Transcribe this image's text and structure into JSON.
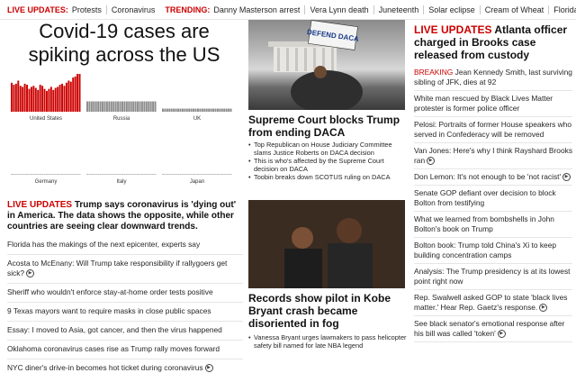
{
  "topbar": {
    "live_label": "LIVE UPDATES:",
    "live_items": [
      "Protests",
      "Coronavirus"
    ],
    "trending_label": "TRENDING:",
    "trending_items": [
      "Danny Masterson arrest",
      "Vera Lynn death",
      "Juneteenth",
      "Solar eclipse",
      "Cream of Wheat",
      "Florida bridge"
    ]
  },
  "left": {
    "chart_title": "Covid-19 cases are spiking across the US",
    "live_prefix": "LIVE UPDATES",
    "live_headline": "Trump says coronavirus is 'dying out' in America. The data shows the opposite, while other countries are seeing clear downward trends.",
    "list": [
      {
        "text": "Florida has the makings of the next epicenter, experts say",
        "video": false
      },
      {
        "text": "Acosta to McEnany: Will Trump take responsibility if rallygoers get sick?",
        "video": true
      },
      {
        "text": "Sheriff who wouldn't enforce stay-at-home order tests positive",
        "video": false
      },
      {
        "text": "9 Texas mayors want to require masks in close public spaces",
        "video": false
      },
      {
        "text": "Essay: I moved to Asia, got cancer, and then the virus happened",
        "video": false
      },
      {
        "text": "Oklahoma coronavirus cases rise as Trump rally moves forward",
        "video": false
      },
      {
        "text": "NYC diner's drive-in becomes hot ticket during coronavirus",
        "video": true
      }
    ]
  },
  "chart_data": {
    "type": "bar",
    "panels": [
      {
        "label": "United States",
        "color": "#cc0000",
        "values": [
          28,
          26,
          27,
          30,
          25,
          24,
          27,
          26,
          22,
          24,
          25,
          23,
          21,
          26,
          25,
          22,
          20,
          22,
          24,
          21,
          23,
          24,
          26,
          27,
          25,
          28,
          30,
          29,
          33,
          34,
          37,
          40
        ]
      },
      {
        "label": "Russia",
        "color": "#8c8c8c",
        "values": [
          10,
          10,
          10,
          10,
          10,
          10,
          10,
          10,
          10,
          10,
          10,
          10,
          10,
          10,
          10,
          10,
          10,
          10,
          10,
          10,
          10,
          10,
          10,
          10,
          10,
          10,
          10,
          10,
          10,
          10,
          10,
          10
        ]
      },
      {
        "label": "UK",
        "color": "#8c8c8c",
        "values": [
          3,
          3,
          3,
          3,
          3,
          3,
          3,
          3,
          3,
          3,
          3,
          3,
          3,
          3,
          3,
          3,
          3,
          3,
          3,
          3,
          3,
          3,
          3,
          3,
          3,
          3,
          3,
          3,
          3,
          3,
          3,
          3
        ]
      },
      {
        "label": "Germany",
        "color": "#8c8c8c",
        "values": [
          0.5,
          0.5,
          0.5,
          0.5,
          0.5,
          0.5,
          0.5,
          0.5,
          0.5,
          0.5,
          0.5,
          0.5,
          0.5,
          0.5,
          0.5,
          0.5,
          0.5,
          0.5,
          0.5,
          0.5,
          0.5,
          0.5,
          0.5,
          0.5,
          0.5,
          0.5,
          0.5,
          0.5,
          0.5,
          0.5,
          0.5,
          0.5
        ]
      },
      {
        "label": "Italy",
        "color": "#8c8c8c",
        "values": [
          0.5,
          0.5,
          0.5,
          0.5,
          0.5,
          0.5,
          0.5,
          0.5,
          0.5,
          0.5,
          0.5,
          0.5,
          0.5,
          0.5,
          0.5,
          0.5,
          0.5,
          0.5,
          0.5,
          0.5,
          0.5,
          0.5,
          0.5,
          0.5,
          0.5,
          0.5,
          0.5,
          0.5,
          0.5,
          0.5,
          0.5,
          0.5
        ]
      },
      {
        "label": "Japan",
        "color": "#8c8c8c",
        "values": [
          0.2,
          0.2,
          0.2,
          0.2,
          0.2,
          0.2,
          0.2,
          0.2,
          0.2,
          0.2,
          0.2,
          0.2,
          0.2,
          0.2,
          0.2,
          0.2,
          0.2,
          0.2,
          0.2,
          0.2,
          0.2,
          0.2,
          0.2,
          0.2,
          0.2,
          0.2,
          0.2,
          0.2,
          0.2,
          0.2,
          0.2,
          0.2
        ]
      }
    ]
  },
  "middle": {
    "photo1_sign": "DEFEND DACA",
    "headline1": "Supreme Court blocks Trump from ending DACA",
    "list1": [
      "Top Republican on House Judiciary Committee slams Justice Roberts on DACA decision",
      "This is who's affected by the Supreme Court decision on DACA",
      "Toobin breaks down SCOTUS ruling on DACA"
    ],
    "headline2": "Records show pilot in Kobe Bryant crash became disoriented in fog",
    "list2": [
      "Vanessa Bryant urges lawmakers to pass helicopter safety bill named for late NBA legend"
    ]
  },
  "right": {
    "live_prefix": "LIVE UPDATES",
    "headline": "Atlanta officer charged in Brooks case released from custody",
    "list": [
      {
        "prefix": "BREAKING",
        "text": "Jean Kennedy Smith, last surviving sibling of JFK, dies at 92",
        "video": false
      },
      {
        "prefix": "",
        "text": "White man rescued by Black Lives Matter protester is former police officer",
        "video": false
      },
      {
        "prefix": "",
        "text": "Pelosi: Portraits of former House speakers who served in Confederacy will be removed",
        "video": false
      },
      {
        "prefix": "",
        "text": "Van Jones: Here's why I think Rayshard Brooks ran",
        "video": true
      },
      {
        "prefix": "",
        "text": "Don Lemon: It's not enough to be 'not racist'",
        "video": true
      },
      {
        "prefix": "",
        "text": "Senate GOP defiant over decision to block Bolton from testifying",
        "video": false
      },
      {
        "prefix": "",
        "text": "What we learned from bombshells in John Bolton's book on Trump",
        "video": false
      },
      {
        "prefix": "",
        "text": "Bolton book: Trump told China's Xi to keep building concentration camps",
        "video": false
      },
      {
        "prefix": "",
        "text": "Analysis: The Trump presidency is at its lowest point right now",
        "video": false
      },
      {
        "prefix": "",
        "text": "Rep. Swalwell asked GOP to state 'black lives matter.' Hear Rep. Gaetz's response.",
        "video": true
      },
      {
        "prefix": "",
        "text": "See black senator's emotional response after his bill was called 'token'",
        "video": true
      }
    ]
  },
  "icons": {
    "play": "play-circle-icon",
    "play_glyph": "▶"
  }
}
